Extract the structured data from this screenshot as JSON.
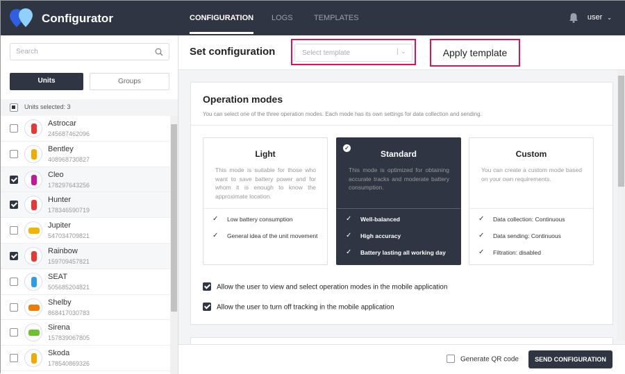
{
  "header": {
    "brand": "Configurator",
    "tabs": [
      {
        "label": "CONFIGURATION"
      },
      {
        "label": "LOGS"
      },
      {
        "label": "TEMPLATES"
      }
    ],
    "user": "user"
  },
  "sidebar": {
    "search_placeholder": "Search",
    "tabs": [
      "Units",
      "Groups"
    ],
    "units_selected": "Units selected: 3",
    "units": [
      {
        "name": "Astrocar",
        "id": "245687462096",
        "checked": false,
        "color": "#e53935"
      },
      {
        "name": "Bentley",
        "id": "408968730827",
        "checked": false,
        "color": "#f2a900"
      },
      {
        "name": "Cleo",
        "id": "178297643256",
        "checked": true,
        "color": "#c2189c"
      },
      {
        "name": "Hunter",
        "id": "178346590719",
        "checked": true,
        "color": "#e53935"
      },
      {
        "name": "Jupiter",
        "id": "547034709821",
        "checked": false,
        "color": "#f2b400"
      },
      {
        "name": "Rainbow",
        "id": "159709457821",
        "checked": true,
        "color": "#e53935"
      },
      {
        "name": "SEAT",
        "id": "505685204821",
        "checked": false,
        "color": "#2f9ee0"
      },
      {
        "name": "Shelby",
        "id": "868417030783",
        "checked": false,
        "color": "#f27a00"
      },
      {
        "name": "Sirena",
        "id": "157839067805",
        "checked": false,
        "color": "#6cc22a"
      },
      {
        "name": "Skoda",
        "id": "178540869326",
        "checked": false,
        "color": "#f2a900"
      }
    ]
  },
  "main": {
    "title": "Set configuration",
    "template_placeholder": "Select template",
    "callout": "Apply template",
    "section_title": "Operation modes",
    "section_desc": "You can select one of the three operation modes. Each mode has its own settings for data collection and sending.",
    "modes": [
      {
        "title": "Light",
        "desc": "This mode is suitable for those who want to save battery power and for whom it is enough to know the approximate location.",
        "features": [
          "Low battery consumption",
          "General idea of the unit movement"
        ]
      },
      {
        "title": "Standard",
        "desc": "This mode is optimized for obtaining accurate tracks and moderate battery consumption.",
        "features": [
          "Well-balanced",
          "High accuracy",
          "Battery lasting all working day"
        ]
      },
      {
        "title": "Custom",
        "desc": "You can create a custom mode based on your own requirements.",
        "features": [
          "Data collection: Continuous",
          "Data sending: Continuous",
          "Filtration: disabled"
        ]
      }
    ],
    "options": [
      "Allow the user to view and select operation modes in the mobile application",
      "Allow the user to turn off tracking in the mobile application"
    ],
    "qr_label": "Generate QR code",
    "send_label": "SEND CONFIGURATION"
  }
}
